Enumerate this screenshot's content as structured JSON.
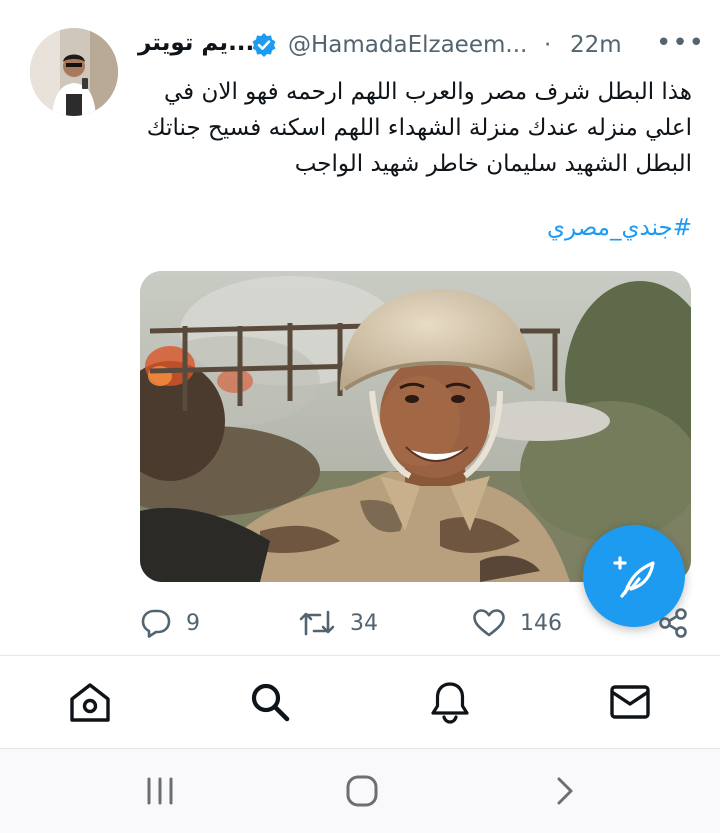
{
  "tweet": {
    "display_name": "...يم تويتر",
    "handle": "@HamadaElzaeem...",
    "separator": "·",
    "time": "22m",
    "more_label": "•••",
    "text_lines": [
      "هذا البطل شرف مصر والعرب اللهم ارحمه فهو الان في",
      "اعلي منزله عندك منزلة الشهداء اللهم اسكنه فسيح جناتك",
      "البطل الشهيد سليمان خاطر شهيد الواجب"
    ],
    "hashtag": "#جندي_مصري",
    "media_icon": "photo-soldier-selfie",
    "fab_icon": "compose-feather-plus-icon"
  },
  "actions": {
    "replies": "9",
    "retweets": "34",
    "likes": "146"
  },
  "tabbar": {
    "items": [
      "home-icon",
      "search-icon",
      "notifications-bell-icon",
      "messages-envelope-icon"
    ]
  },
  "system_nav": {
    "items": [
      "recent-apps-icon",
      "home-circle-icon",
      "back-chevron-icon"
    ]
  },
  "colors": {
    "accent": "#1d9bf0",
    "secondary_text": "#536471",
    "primary_text": "#0f1419"
  }
}
